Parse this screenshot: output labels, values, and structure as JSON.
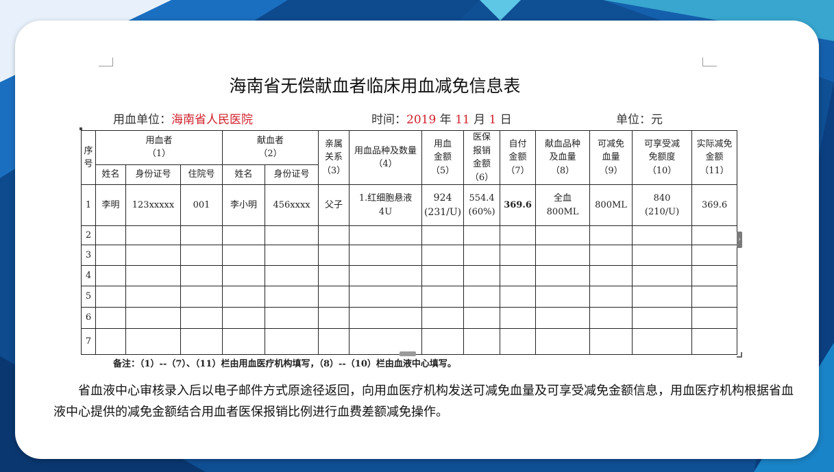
{
  "document": {
    "title": "海南省无偿献血者临床用血减免信息表",
    "meta": {
      "unit_label": "用血单位：",
      "unit_value": "海南省人民医院",
      "time_label": "时间：",
      "year": "2019",
      "year_suffix": " 年 ",
      "month": "11",
      "month_suffix": " 月 ",
      "day": "1",
      "day_suffix": " 日",
      "currency": "单位：元"
    },
    "table": {
      "headers": {
        "seq": "序号",
        "recipient": "用血者",
        "recipient_no": "（1）",
        "donor": "献血者",
        "donor_no": "（2）",
        "relation": "亲属关系",
        "relation_no": "（3）",
        "product": "用血品种及数量",
        "product_no": "（4）",
        "amount": "用血金额",
        "amount_no": "（5）",
        "insurance": "医保报销金额",
        "insurance_no": "（6）",
        "selfpay": "自付金额",
        "selfpay_no": "（7）",
        "donated": "献血品种及血量",
        "donated_no": "（8）",
        "reducible": "可减免血量",
        "reducible_no": "（9）",
        "entitled": "可享受减免额度",
        "entitled_no": "（10）",
        "actual": "实际减免金额",
        "actual_no": "（11）",
        "name": "姓名",
        "id_no": "身份证号",
        "inpatient_no": "住院号"
      },
      "row1": {
        "seq": "1",
        "recipient_name": "李明",
        "recipient_id": "123xxxxx",
        "inpatient_no": "001",
        "donor_name": "李小明",
        "donor_id": "456xxxx",
        "relation": "父子",
        "product_line1": "1.红细胞悬液",
        "product_line2": "4U",
        "amount_line1": "924",
        "amount_line2": "(231/U)",
        "insurance_line1": "554.4",
        "insurance_line2": "(60%)",
        "selfpay": "369.6",
        "donated_line1": "全血",
        "donated_line2": "800ML",
        "reducible": "800ML",
        "entitled_line1": "840",
        "entitled_line2": "(210/U)",
        "actual": "369.6"
      },
      "empty_rows": [
        "2",
        "3",
        "4",
        "5",
        "6",
        "7"
      ]
    },
    "note": "备注：（1）--（7）、（11）栏由用血医疗机构填写，（8）--（10）栏由血液中心填写。",
    "paragraph": "省血液中心审核录入后以电子邮件方式原途径返回，向用血医疗机构发送可减免血量及可享受减免金额信息，用血医疗机构根据省血液中心提供的减免金额结合用血者医保报销比例进行血费差额减免操作。"
  },
  "colors": {
    "background": "#0f4f94",
    "card": "#ffffff",
    "red_text": "#d0202a",
    "blue_text": "#1f6fb5"
  }
}
